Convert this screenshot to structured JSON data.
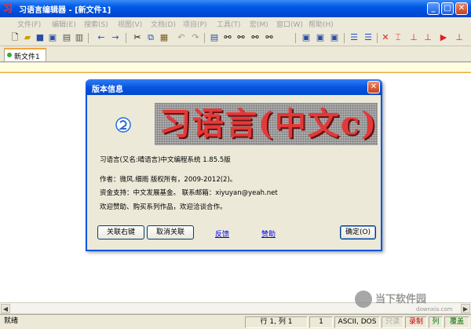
{
  "window": {
    "title": "习语言编辑器 - [新文件1]",
    "app_icon_glyph": "习",
    "buttons": {
      "minimize": "_",
      "maximize": "□",
      "close": "✕"
    }
  },
  "menu": [
    "文件(F)",
    "编辑(E)",
    "搜索(S)",
    "视图(V)",
    "文档(D)",
    "项目(P)",
    "工具(T)",
    "宏(M)",
    "窗口(W)",
    "帮助(H)"
  ],
  "toolbar": {
    "icons": [
      "new-file-icon",
      "open-file-icon",
      "save-icon",
      "save-all-icon",
      "print-icon",
      "print-preview-icon",
      "back-icon",
      "forward-icon",
      "cut-icon",
      "copy-icon",
      "paste-icon",
      "undo-icon",
      "redo-icon",
      "find-icon",
      "replace-icon",
      "find-in-files-icon",
      "window-icon",
      "window-list-icon",
      "panel-icon",
      "indent-icon",
      "outdent-icon",
      "stop-icon",
      "build-icon",
      "run-icon",
      "debug-icon",
      "step-icon",
      "breakpoint-icon"
    ]
  },
  "tabs": [
    {
      "label": "新文件1",
      "active": true
    }
  ],
  "dialog": {
    "title": "版本信息",
    "banner_text": "习语言(中文c)",
    "line1": "习语言(又名:晴语言)中文编程系统  1.85.5版",
    "line2": "作者：微风.细雨   版权所有，2009-2012(2)。",
    "line3": "资金支持：中文发展基金。    联系邮箱：xiyuyan@yeah.net",
    "line4": "欢迎赞助、购买系列作品，欢迎洽谈合作。",
    "buttons": {
      "assoc": "关联右键",
      "unassoc": "取消关联",
      "ok": "确定(O)"
    },
    "links": {
      "feedback": "反馈",
      "sponsor": "赞助"
    }
  },
  "statusbar": {
    "ready": "就绪",
    "position": "行 1,  列 1",
    "num": "1",
    "encoding": "ASCII, DOS",
    "readonly": "只读",
    "record": "录制",
    "column": "列",
    "overwrite": "覆盖"
  },
  "watermark": {
    "text": "当下软件园",
    "url": "downxia.com"
  },
  "colors": {
    "accent": "#0054e3",
    "tab_highlight": "#f2a53b",
    "banner_text": "#e23a3a"
  }
}
